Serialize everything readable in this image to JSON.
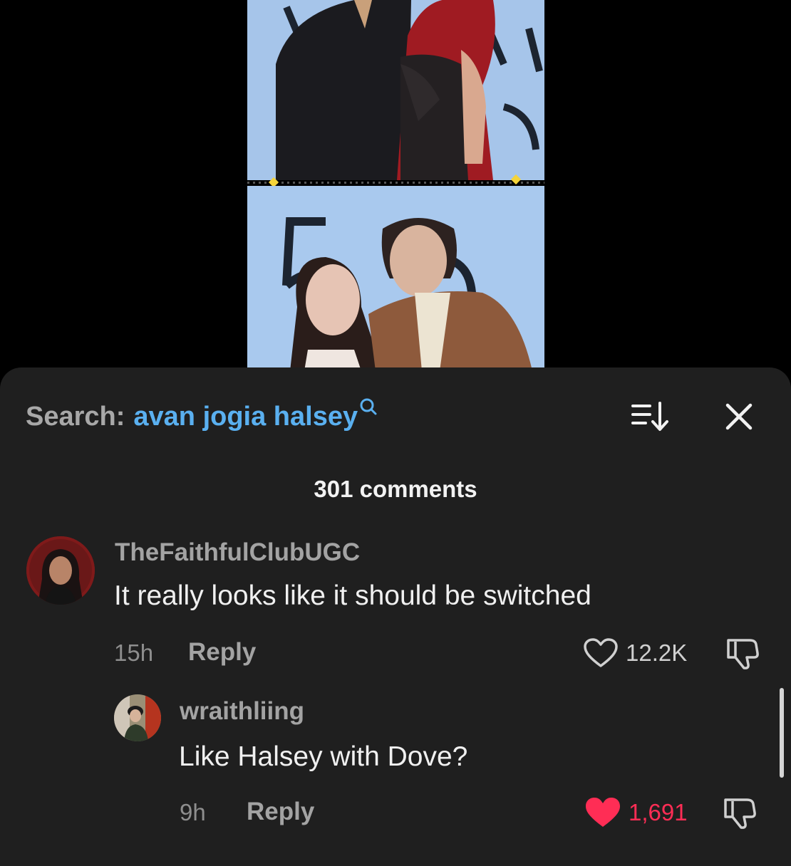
{
  "search": {
    "prefix": "Search:",
    "query": "avan jogia halsey"
  },
  "comments_header": {
    "count_label": "301 comments"
  },
  "icons": {
    "search": "search-icon",
    "sort": "sort-icon",
    "close": "close-icon",
    "like": "heart-icon",
    "dislike": "thumbs-down-icon"
  },
  "colors": {
    "sheet_bg": "#1f1f1f",
    "query_blue": "#5ab0f0",
    "liked_red": "#ff2d55",
    "muted_text": "#a3a3a3"
  },
  "comments": [
    {
      "username": "TheFaithfulClubUGC",
      "text": "It really looks like it should be switched",
      "time": "15h",
      "reply_label": "Reply",
      "likes": "12.2K",
      "liked": false
    },
    {
      "username": "wraithliing",
      "text": "Like Halsey with Dove?",
      "time": "9h",
      "reply_label": "Reply",
      "likes": "1,691",
      "liked": true
    }
  ]
}
